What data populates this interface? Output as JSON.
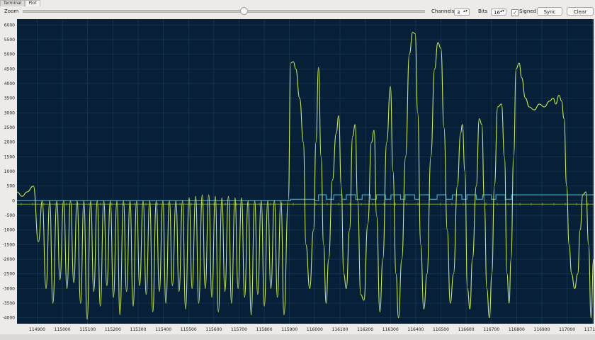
{
  "tabs": [
    {
      "label": "Terminal",
      "active": false
    },
    {
      "label": "Plot",
      "active": true
    }
  ],
  "toolbar": {
    "zoom_label": "Zoom",
    "zoom_level": 0.55,
    "channels_label": "Channels",
    "channels_value": "3",
    "bits_label": "Bits",
    "bits_value": "16",
    "signed_label": "Signed",
    "signed_checked": true,
    "check_glyph": "✓",
    "spin_glyph": "▴▾",
    "sync_label": "Sync",
    "clear_label": "Clear"
  },
  "colors": {
    "plot_background": "#072038",
    "grid": "#1e3d5a",
    "axis_text": "#222222",
    "channel_1": "#c9e85a",
    "channel_2": "#2fb8d0",
    "channel_3": "#7a9a3a"
  },
  "chart_data": {
    "type": "line",
    "y_range": [
      -4200,
      6200
    ],
    "x_range": [
      114820,
      117105
    ],
    "y_ticks": [
      "6000",
      "5500",
      "5000",
      "4500",
      "4000",
      "3500",
      "3000",
      "2500",
      "2000",
      "1500",
      "1000",
      "500",
      "0",
      "-500",
      "-1000",
      "-1500",
      "-2000",
      "-2500",
      "-3000",
      "-3500",
      "-4000"
    ],
    "x_ticks": [
      "114900",
      "115000",
      "115100",
      "115200",
      "115300",
      "115400",
      "115500",
      "115600",
      "115700",
      "115800",
      "115900",
      "116000",
      "116100",
      "116200",
      "116300",
      "116400",
      "116500",
      "116600",
      "116700",
      "116800",
      "116900",
      "117000",
      "117100"
    ],
    "grid": true,
    "series": [
      {
        "peaks": [
          [
            114820,
            300
          ],
          [
            114840,
            150
          ],
          [
            114860,
            300
          ],
          [
            114885,
            500
          ],
          [
            114905,
            -1400
          ],
          [
            114920,
            0
          ],
          [
            114935,
            -3000
          ],
          [
            114950,
            0
          ],
          [
            114962,
            -3500
          ],
          [
            114978,
            0
          ],
          [
            114990,
            -2700
          ],
          [
            115005,
            0
          ],
          [
            115018,
            -3000
          ],
          [
            115032,
            0
          ],
          [
            115045,
            -2800
          ],
          [
            115058,
            0
          ],
          [
            115072,
            -3500
          ],
          [
            115085,
            0
          ],
          [
            115098,
            -4050
          ],
          [
            115112,
            0
          ],
          [
            115124,
            -3100
          ],
          [
            115138,
            0
          ],
          [
            115150,
            -3600
          ],
          [
            115164,
            0
          ],
          [
            115176,
            -2900
          ],
          [
            115190,
            0
          ],
          [
            115202,
            -3300
          ],
          [
            115216,
            0
          ],
          [
            115228,
            -3900
          ],
          [
            115242,
            0
          ],
          [
            115254,
            -3100
          ],
          [
            115268,
            0
          ],
          [
            115280,
            -3600
          ],
          [
            115294,
            0
          ],
          [
            115306,
            -2900
          ],
          [
            115320,
            0
          ],
          [
            115332,
            -3200
          ],
          [
            115346,
            0
          ],
          [
            115358,
            -3800
          ],
          [
            115372,
            0
          ],
          [
            115384,
            -3100
          ],
          [
            115398,
            0
          ],
          [
            115410,
            -3500
          ],
          [
            115424,
            0
          ],
          [
            115436,
            -2900
          ],
          [
            115450,
            0
          ],
          [
            115462,
            -3100
          ],
          [
            115476,
            0
          ],
          [
            115488,
            -3700
          ],
          [
            115502,
            100
          ],
          [
            115514,
            -3000
          ],
          [
            115528,
            150
          ],
          [
            115540,
            -3500
          ],
          [
            115554,
            200
          ],
          [
            115566,
            -3000
          ],
          [
            115580,
            200
          ],
          [
            115592,
            -3300
          ],
          [
            115606,
            150
          ],
          [
            115618,
            -3800
          ],
          [
            115632,
            100
          ],
          [
            115644,
            -3100
          ],
          [
            115658,
            150
          ],
          [
            115670,
            -3500
          ],
          [
            115684,
            100
          ],
          [
            115696,
            -3000
          ],
          [
            115710,
            100
          ],
          [
            115722,
            -3300
          ],
          [
            115736,
            0
          ],
          [
            115748,
            -3900
          ],
          [
            115762,
            0
          ],
          [
            115774,
            -3200
          ],
          [
            115788,
            0
          ],
          [
            115800,
            -3600
          ],
          [
            115814,
            0
          ],
          [
            115826,
            -3000
          ],
          [
            115840,
            0
          ],
          [
            115852,
            -3300
          ],
          [
            115866,
            0
          ],
          [
            115878,
            -3900
          ],
          [
            115895,
            0
          ],
          [
            115905,
            4700
          ],
          [
            115915,
            4750
          ],
          [
            115925,
            4500
          ],
          [
            115940,
            3500
          ],
          [
            115955,
            2000
          ],
          [
            115965,
            -1500
          ],
          [
            115980,
            -3000
          ],
          [
            115995,
            -1000
          ],
          [
            116005,
            2000
          ],
          [
            116015,
            4550
          ],
          [
            116025,
            1500
          ],
          [
            116035,
            -1500
          ],
          [
            116045,
            -3500
          ],
          [
            116055,
            -2000
          ],
          [
            116070,
            700
          ],
          [
            116085,
            2300
          ],
          [
            116095,
            2900
          ],
          [
            116105,
            500
          ],
          [
            116115,
            -2500
          ],
          [
            116125,
            -3000
          ],
          [
            116138,
            -1000
          ],
          [
            116150,
            2200
          ],
          [
            116160,
            2600
          ],
          [
            116170,
            0
          ],
          [
            116182,
            -3200
          ],
          [
            116195,
            -3400
          ],
          [
            116210,
            -800
          ],
          [
            116225,
            2000
          ],
          [
            116235,
            2400
          ],
          [
            116245,
            -500
          ],
          [
            116258,
            -3800
          ],
          [
            116270,
            -2000
          ],
          [
            116285,
            2000
          ],
          [
            116300,
            3900
          ],
          [
            116310,
            1000
          ],
          [
            116322,
            -2500
          ],
          [
            116332,
            -4000
          ],
          [
            116345,
            -2000
          ],
          [
            116360,
            1500
          ],
          [
            116375,
            5000
          ],
          [
            116388,
            5750
          ],
          [
            116398,
            5700
          ],
          [
            116408,
            3000
          ],
          [
            116420,
            -1500
          ],
          [
            116432,
            -3700
          ],
          [
            116445,
            -2500
          ],
          [
            116460,
            1500
          ],
          [
            116475,
            4500
          ],
          [
            116488,
            5400
          ],
          [
            116500,
            5200
          ],
          [
            116512,
            2500
          ],
          [
            116525,
            -1000
          ],
          [
            116537,
            -3500
          ],
          [
            116550,
            -2500
          ],
          [
            116565,
            500
          ],
          [
            116578,
            2300
          ],
          [
            116585,
            2600
          ],
          [
            116595,
            1000
          ],
          [
            116605,
            -3000
          ],
          [
            116615,
            -3700
          ],
          [
            116625,
            -2000
          ],
          [
            116640,
            500
          ],
          [
            116652,
            2800
          ],
          [
            116662,
            2600
          ],
          [
            116672,
            0
          ],
          [
            116682,
            -3000
          ],
          [
            116692,
            -4000
          ],
          [
            116702,
            -2500
          ],
          [
            116712,
            500
          ],
          [
            116725,
            3200
          ],
          [
            116740,
            3300
          ],
          [
            116752,
            1500
          ],
          [
            116762,
            -2500
          ],
          [
            116770,
            -3500
          ],
          [
            116778,
            -2000
          ],
          [
            116788,
            1500
          ],
          [
            116798,
            4500
          ],
          [
            116810,
            4700
          ],
          [
            116820,
            4200
          ],
          [
            116835,
            3500
          ],
          [
            116850,
            3200
          ],
          [
            116870,
            3100
          ],
          [
            116890,
            3300
          ],
          [
            116910,
            3200
          ],
          [
            116930,
            3400
          ],
          [
            116945,
            3500
          ],
          [
            116955,
            3300
          ],
          [
            116968,
            3600
          ],
          [
            116978,
            3400
          ],
          [
            116988,
            2800
          ],
          [
            116998,
            500
          ],
          [
            117008,
            -1500
          ],
          [
            117018,
            -2500
          ],
          [
            117030,
            -3000
          ],
          [
            117042,
            -2500
          ],
          [
            117052,
            -1000
          ],
          [
            117062,
            200
          ],
          [
            117075,
            300
          ],
          [
            117085,
            -1500
          ],
          [
            117095,
            -4000
          ],
          [
            117105,
            -2000
          ]
        ]
      },
      {
        "steps": [
          [
            114820,
            0
          ],
          [
            115905,
            0
          ],
          [
            115905,
            50
          ],
          [
            116000,
            50
          ],
          [
            116000,
            0
          ],
          [
            116015,
            0
          ],
          [
            116015,
            200
          ],
          [
            116045,
            200
          ],
          [
            116045,
            50
          ],
          [
            116075,
            50
          ],
          [
            116075,
            200
          ],
          [
            116108,
            200
          ],
          [
            116108,
            50
          ],
          [
            116125,
            50
          ],
          [
            116125,
            200
          ],
          [
            116162,
            200
          ],
          [
            116162,
            50
          ],
          [
            116188,
            50
          ],
          [
            116188,
            200
          ],
          [
            116222,
            200
          ],
          [
            116222,
            50
          ],
          [
            116245,
            50
          ],
          [
            116245,
            200
          ],
          [
            116280,
            200
          ],
          [
            116280,
            50
          ],
          [
            116302,
            50
          ],
          [
            116302,
            200
          ],
          [
            116340,
            200
          ],
          [
            116340,
            50
          ],
          [
            116358,
            50
          ],
          [
            116358,
            200
          ],
          [
            116396,
            200
          ],
          [
            116396,
            50
          ],
          [
            116415,
            50
          ],
          [
            116415,
            200
          ],
          [
            116455,
            200
          ],
          [
            116455,
            50
          ],
          [
            116485,
            50
          ],
          [
            116485,
            200
          ],
          [
            116520,
            200
          ],
          [
            116520,
            50
          ],
          [
            116545,
            50
          ],
          [
            116545,
            200
          ],
          [
            116583,
            200
          ],
          [
            116583,
            50
          ],
          [
            116603,
            50
          ],
          [
            116603,
            200
          ],
          [
            116640,
            200
          ],
          [
            116640,
            50
          ],
          [
            116665,
            50
          ],
          [
            116665,
            200
          ],
          [
            116700,
            200
          ],
          [
            116700,
            50
          ],
          [
            116718,
            50
          ],
          [
            116718,
            200
          ],
          [
            116755,
            200
          ],
          [
            116755,
            50
          ],
          [
            116780,
            50
          ],
          [
            116780,
            200
          ],
          [
            117105,
            200
          ]
        ]
      },
      {
        "flat_value": -120
      }
    ]
  }
}
